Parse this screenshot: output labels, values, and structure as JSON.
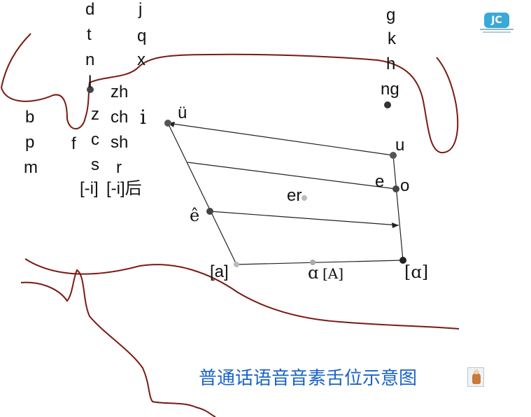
{
  "title": "普通话语音音素舌位示意图",
  "colors": {
    "tongue_outline": "#7a1a12",
    "lines": "#222222",
    "title": "#1a63c9"
  },
  "logo": {
    "text": "JC"
  },
  "speaker_icon": "speaker-teacher-icon",
  "initials": {
    "labial": [
      "b",
      "p",
      "m"
    ],
    "labiodental": "f",
    "alveolar": [
      "d",
      "t",
      "n",
      "l"
    ],
    "dental_sibilants": [
      "z",
      "c",
      "s"
    ],
    "retroflex": [
      "zh",
      "ch",
      "sh",
      "r"
    ],
    "palatal": [
      "j",
      "q",
      "x"
    ],
    "velar": [
      "g",
      "k",
      "h",
      "ng"
    ]
  },
  "apical_vowels": {
    "front": "[-i]",
    "back": "[-i]后"
  },
  "vowels": {
    "i": "i",
    "yu": "ü",
    "u": "u",
    "e": "e",
    "o": "o",
    "er": "er",
    "ehat": "ê",
    "a_front": "[a]",
    "a_central": "ɑ",
    "a_central_ipa": "[A]",
    "a_back": "[ɑ]"
  }
}
